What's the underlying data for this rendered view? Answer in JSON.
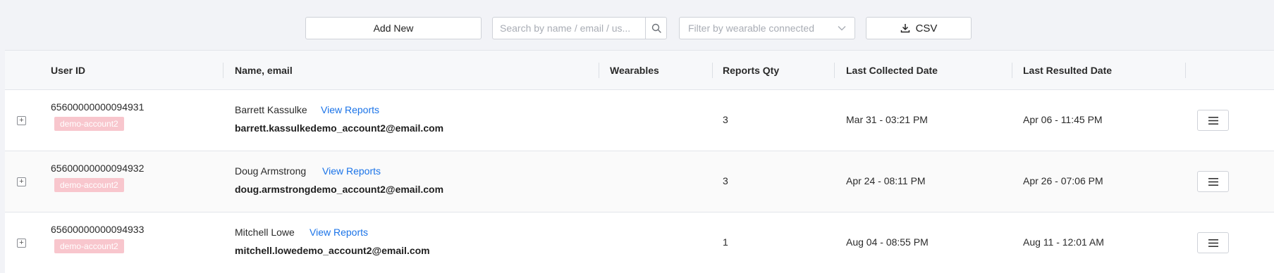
{
  "toolbar": {
    "add_new_label": "Add New",
    "search_placeholder": "Search by name / email / us...",
    "search_icon": "search-icon",
    "filter_placeholder": "Filter by wearable connected",
    "csv_label": "CSV",
    "csv_icon": "download-icon"
  },
  "table": {
    "headers": [
      "User ID",
      "Name, email",
      "Wearables",
      "Reports Qty",
      "Last Collected Date",
      "Last Resulted Date"
    ],
    "rows": [
      {
        "user_id": "65600000000094931",
        "tag": "demo-account2",
        "name": "Barrett Kassulke",
        "link": "View Reports",
        "email": "barrett.kassulkedemo_account2@email.com",
        "wearables": "",
        "reports_qty": "3",
        "last_collected": "Mar 31 - 03:21 PM",
        "last_resulted": "Apr 06 - 11:45 PM"
      },
      {
        "user_id": "65600000000094932",
        "tag": "demo-account2",
        "name": "Doug Armstrong",
        "link": "View Reports",
        "email": "doug.armstrongdemo_account2@email.com",
        "wearables": "",
        "reports_qty": "3",
        "last_collected": "Apr 24 - 08:11 PM",
        "last_resulted": "Apr 26 - 07:06 PM"
      },
      {
        "user_id": "65600000000094933",
        "tag": "demo-account2",
        "name": "Mitchell Lowe",
        "link": "View Reports",
        "email": "mitchell.lowedemo_account2@email.com",
        "wearables": "",
        "reports_qty": "1",
        "last_collected": "Aug 04 - 08:55 PM",
        "last_resulted": "Aug 11 - 12:01 AM"
      }
    ]
  },
  "colors": {
    "link": "#1a73e8",
    "tag_bg": "#f8c6cd",
    "page_bg": "#f2f3f7"
  }
}
